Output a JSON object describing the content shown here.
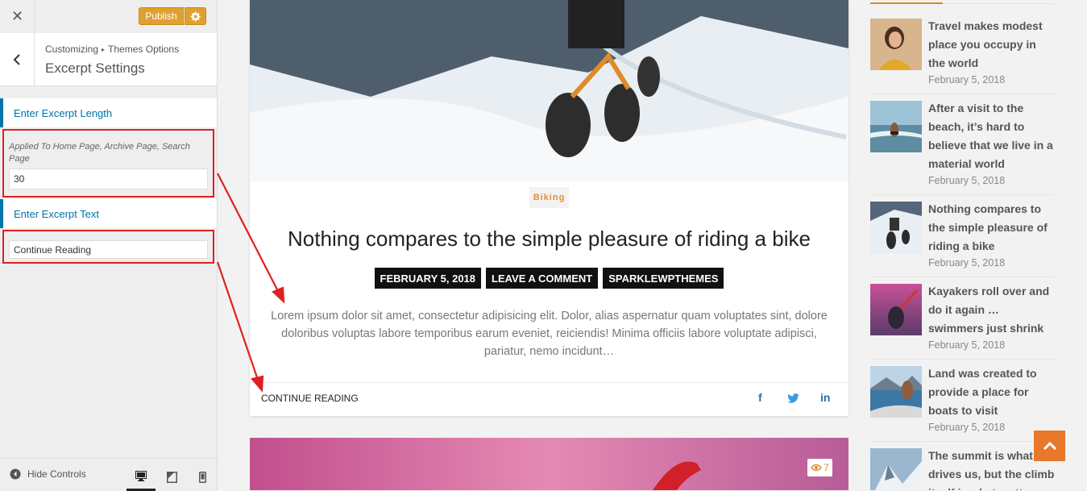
{
  "customizer": {
    "close_icon": "close-icon",
    "publish_label": "Publish",
    "breadcrumb": {
      "root": "Customizing",
      "separator": "▸",
      "parent": "Themes Options"
    },
    "section_title": "Excerpt Settings",
    "controls": {
      "length_label": "Enter Excerpt Length",
      "length_description": "Applied To Home Page, Archive Page, Search Page",
      "length_value": "30",
      "text_label": "Enter Excerpt Text",
      "text_value": "Continue Reading"
    },
    "footer": {
      "hide_controls": "Hide Controls"
    },
    "colors": {
      "publish": "#e0a030",
      "accent": "#0073aa",
      "highlight_box": "#e02020"
    }
  },
  "post": {
    "category": "Biking",
    "title": "Nothing compares to the simple pleasure of riding a bike",
    "meta": [
      "FEBRUARY 5, 2018",
      "LEAVE A COMMENT",
      "SPARKLEWPTHEMES"
    ],
    "excerpt": "Lorem ipsum dolor sit amet, consectetur adipisicing elit. Dolor, alias aspernatur quam voluptates sint, dolore doloribus voluptas labore temporibus earum eveniet, reiciendis! Minima officiis labore voluptate adipisci, pariatur, nemo incidunt…",
    "read_more": "CONTINUE READING",
    "share": {
      "facebook": "f",
      "twitter": "twitter-icon",
      "linkedin": "in"
    },
    "next_post_views": "7"
  },
  "sidebar": {
    "items": [
      {
        "title": "Travel makes modest place you occupy in the world",
        "date": "February 5, 2018"
      },
      {
        "title": "After a visit to the beach, it’s hard to believe that we live in a material world",
        "date": "February 5, 2018"
      },
      {
        "title": "Nothing compares to the simple pleasure of riding a bike",
        "date": "February 5, 2018"
      },
      {
        "title": "Kayakers roll over and do it again … swimmers just shrink",
        "date": "February 5, 2018"
      },
      {
        "title": "Land was created to provide a place for boats to visit",
        "date": "February 5, 2018"
      },
      {
        "title": "The summit is what drives us, but the climb itself is what matters",
        "date": ""
      }
    ]
  },
  "accent_color": "#e8782a"
}
